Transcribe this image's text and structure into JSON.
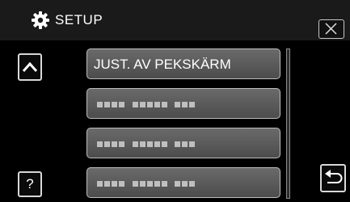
{
  "header": {
    "title": "SETUP"
  },
  "menu": {
    "items": [
      {
        "label": "JUST. AV PEKSKÄRM"
      },
      {
        "label": ""
      },
      {
        "label": ""
      },
      {
        "label": ""
      }
    ]
  },
  "icons": {
    "settings": "gear-icon",
    "close": "close-icon",
    "up": "chevron-up-icon",
    "help": "question-mark-icon",
    "back": "return-arrow-icon"
  },
  "help_button": {
    "glyph": "?"
  },
  "colors": {
    "background": "#000000",
    "header": "#1a1a1a",
    "item_fill": "#5a5a5a",
    "item_border": "#bdbdbd"
  }
}
